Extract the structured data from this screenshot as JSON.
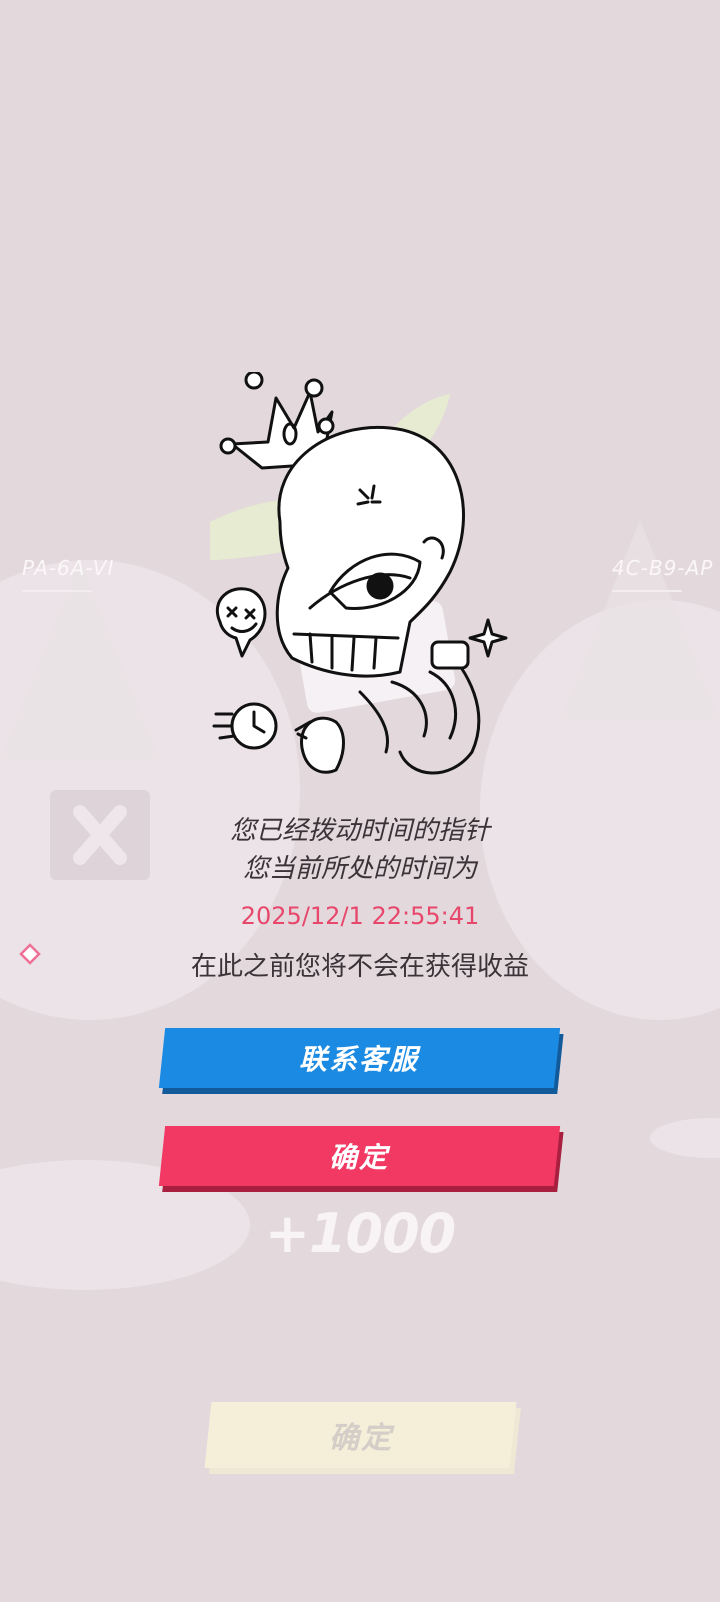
{
  "background": {
    "left_code": "PA-6A-VI",
    "right_code": "4C-B9-AP"
  },
  "dialog": {
    "line1": "您已经拨动时间的指针",
    "line2": "您当前所处的时间为",
    "time": "2025/12/1 22:55:41",
    "line3": "在此之前您将不会在获得收益",
    "contact_button": "联系客服",
    "confirm_button": "确定"
  },
  "reward": {
    "amount_text": "+1000"
  },
  "bottom": {
    "confirm_button": "确定"
  },
  "colors": {
    "background": "#e3d9dd",
    "contact_blue": "#1b8ae2",
    "confirm_red": "#f13963",
    "time_red": "#e7476b",
    "faded_yellow": "#f5efd9"
  }
}
